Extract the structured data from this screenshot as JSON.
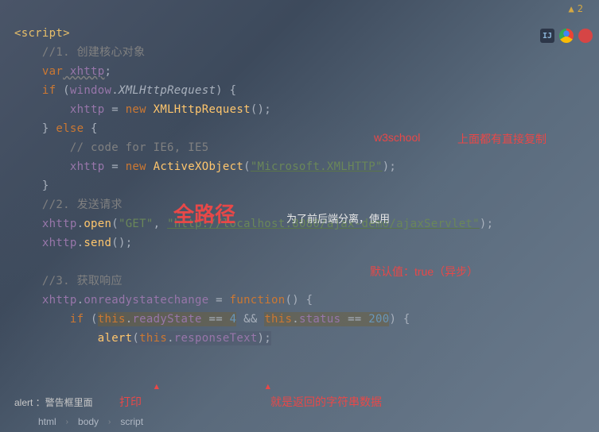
{
  "warnings": {
    "icon": "▲",
    "count": "2"
  },
  "annotations": {
    "w3school": "w3school",
    "copy_above": "上面都有直接复制",
    "full_path": "全路径",
    "separation": "为了前后端分离，使用",
    "default_async": "默认值：true（异步）",
    "print": "打印",
    "return_data": "就是返回的字符串数据",
    "alert_box": "alert ：警告框里面"
  },
  "breadcrumb": {
    "item1": "html",
    "item2": "body",
    "item3": "script"
  },
  "code": {
    "t01": "<script>",
    "t02": "//1. 创建核心对象",
    "t03a": "var",
    "t03b": " xhttp",
    "t03c": ";",
    "t04a": "if",
    "t04b": " (",
    "t04c": "window",
    "t04d": ".",
    "t04e": "XMLHttpRequest",
    "t04f": ") {",
    "t05a": "xhttp",
    "t05b": " = ",
    "t05c": "new",
    "t05d": " ",
    "t05e": "XMLHttpRequest",
    "t05f": "();",
    "t06a": "} ",
    "t06b": "else",
    "t06c": " {",
    "t07": "// code for IE6, IE5",
    "t08a": "xhttp",
    "t08b": " = ",
    "t08c": "new",
    "t08d": " ",
    "t08e": "ActiveXObject",
    "t08f": "(",
    "t08g": "\"Microsoft.XMLHTTP\"",
    "t08h": ");",
    "t09": "}",
    "t10": "//2. 发送请求",
    "t11a": "xhttp",
    "t11b": ".",
    "t11c": "open",
    "t11d": "(",
    "t11e": "\"GET\"",
    "t11f": ", ",
    "t11g": "\"http://localhost:8080/ajax-demo/ajaxServlet\"",
    "t11h": ");",
    "t12a": "xhttp",
    "t12b": ".",
    "t12c": "send",
    "t12d": "();",
    "t14": "//3. 获取响应",
    "t15a": "xhttp",
    "t15b": ".",
    "t15c": "onreadystatechange",
    "t15d": " = ",
    "t15e": "function",
    "t15f": "() {",
    "t16a": "if",
    "t16b": " (",
    "t16c": "this",
    "t16d": ".",
    "t16e": "readyState",
    "t16f": " == ",
    "t16g": "4",
    "t16h": " && ",
    "t16i": "this",
    "t16j": ".",
    "t16k": "status",
    "t16l": " == ",
    "t16m": "200",
    "t16n": ") {",
    "t17a": "alert",
    "t17b": "(",
    "t17c": "this",
    "t17d": ".",
    "t17e": "responseText",
    "t17f": ");"
  }
}
